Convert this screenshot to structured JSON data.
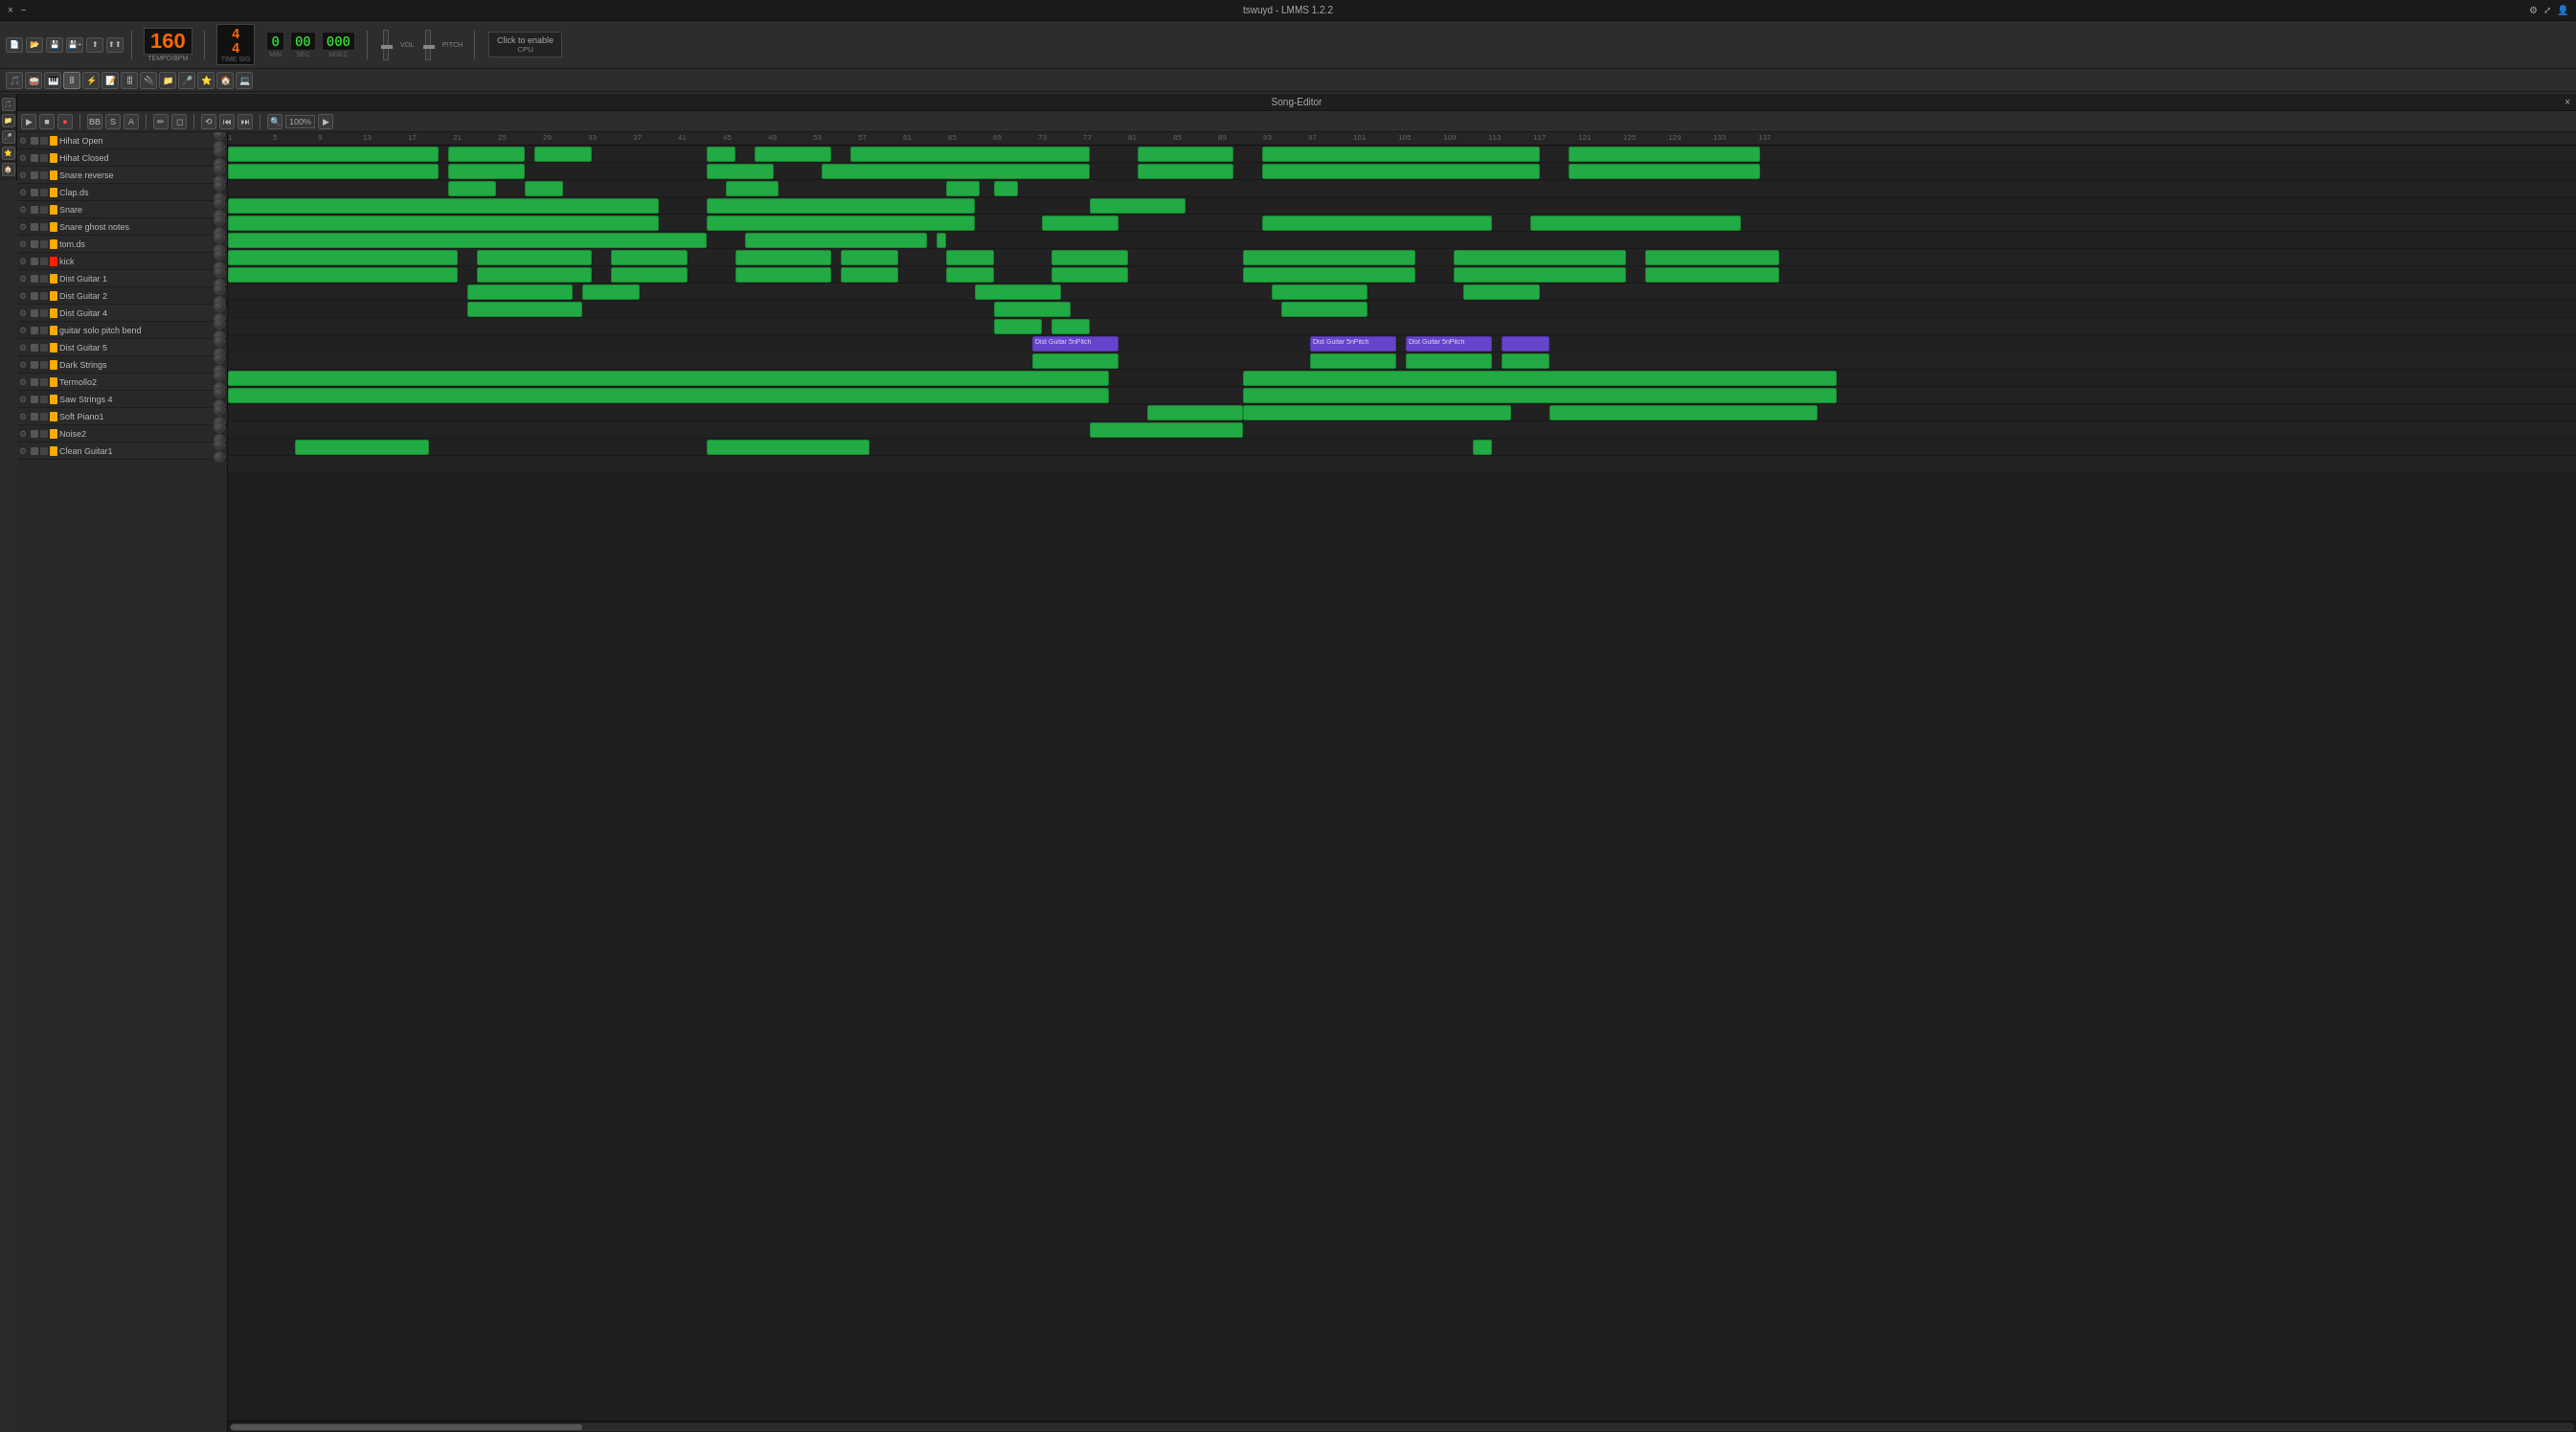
{
  "app": {
    "title": "tswuyd - LMMS 1.2.2",
    "window_controls": [
      "×",
      "−",
      "□"
    ]
  },
  "title_bar": {
    "title": "tswuyd - LMMS 1.2.2",
    "close": "×",
    "minimize": "−",
    "maximize": "□"
  },
  "main_toolbar": {
    "tempo": {
      "label": "TEMPO/BPM",
      "value": "160"
    },
    "time_sig": {
      "label": "TIME SIG",
      "numerator": "4",
      "denominator": "4"
    },
    "digital_time": {
      "min": {
        "label": "MIN",
        "value": "0"
      },
      "sec": {
        "label": "SEC",
        "value": "00"
      },
      "msec": {
        "label": "MSEC",
        "value": "000"
      }
    },
    "cpu": {
      "click_label": "Click to enable",
      "cpu_label": "CPU"
    }
  },
  "song_editor": {
    "title": "Song-Editor",
    "close_btn": "×",
    "zoom_label": "100%"
  },
  "se_toolbar": {
    "play": "▶",
    "stop": "■",
    "record": "●",
    "add_bb": "+BB",
    "add_sample": "+S",
    "add_automation": "+A",
    "draw_mode": "✏",
    "erase_mode": "⌫",
    "loop_btn": "⟲",
    "rewind": "⏮",
    "forward": "⏭",
    "zoom": "🔍",
    "zoom_val": "100%"
  },
  "tracks": [
    {
      "id": 1,
      "name": "Hihat Open",
      "color": "#ffaa00",
      "type": "beat",
      "has_content": true
    },
    {
      "id": 2,
      "name": "Hihat Closed",
      "color": "#ffaa00",
      "type": "beat",
      "has_content": true
    },
    {
      "id": 3,
      "name": "Snare reverse",
      "color": "#ffaa00",
      "type": "beat",
      "has_content": true
    },
    {
      "id": 4,
      "name": "Clap.ds",
      "color": "#ffaa00",
      "type": "beat",
      "has_content": true
    },
    {
      "id": 5,
      "name": "Snare",
      "color": "#ffaa00",
      "type": "beat",
      "has_content": true
    },
    {
      "id": 6,
      "name": "Snare ghost notes",
      "color": "#ffaa00",
      "type": "beat",
      "has_content": true
    },
    {
      "id": 7,
      "name": "tom.ds",
      "color": "#ffaa00",
      "type": "beat",
      "has_content": true
    },
    {
      "id": 8,
      "name": "kick",
      "color": "#ff2200",
      "type": "beat",
      "has_content": true
    },
    {
      "id": 9,
      "name": "Dist Guitar 1",
      "color": "#ffaa00",
      "type": "instrument",
      "has_content": true
    },
    {
      "id": 10,
      "name": "Dist Guitar 2",
      "color": "#ffaa00",
      "type": "instrument",
      "has_content": true
    },
    {
      "id": 11,
      "name": "Dist Guitar 4",
      "color": "#ffaa00",
      "type": "instrument",
      "has_content": true
    },
    {
      "id": 12,
      "name": "guitar solo pitch bend",
      "color": "#ffaa00",
      "type": "instrument",
      "has_content": true
    },
    {
      "id": 13,
      "name": "Dist Guitar 5",
      "color": "#ffaa00",
      "type": "instrument",
      "has_content": true
    },
    {
      "id": 14,
      "name": "Dark Strings",
      "color": "#ffaa00",
      "type": "instrument",
      "has_content": true
    },
    {
      "id": 15,
      "name": "Termollo2",
      "color": "#ffaa00",
      "type": "instrument",
      "has_content": true
    },
    {
      "id": 16,
      "name": "Saw Strings 4",
      "color": "#ffaa00",
      "type": "instrument",
      "has_content": true
    },
    {
      "id": 17,
      "name": "Soft Piano1",
      "color": "#ffaa00",
      "type": "instrument",
      "has_content": true
    },
    {
      "id": 18,
      "name": "Noise2",
      "color": "#ffaa00",
      "type": "instrument",
      "has_content": true
    },
    {
      "id": 19,
      "name": "Clean Guitar1",
      "color": "#ffaa00",
      "type": "instrument",
      "has_content": true
    }
  ],
  "colors": {
    "green_pattern": "#22aa44",
    "purple_pattern": "#6644cc",
    "accent_orange": "#ff6600",
    "bg_dark": "#1e1e1e",
    "bg_medium": "#2a2a2a"
  }
}
